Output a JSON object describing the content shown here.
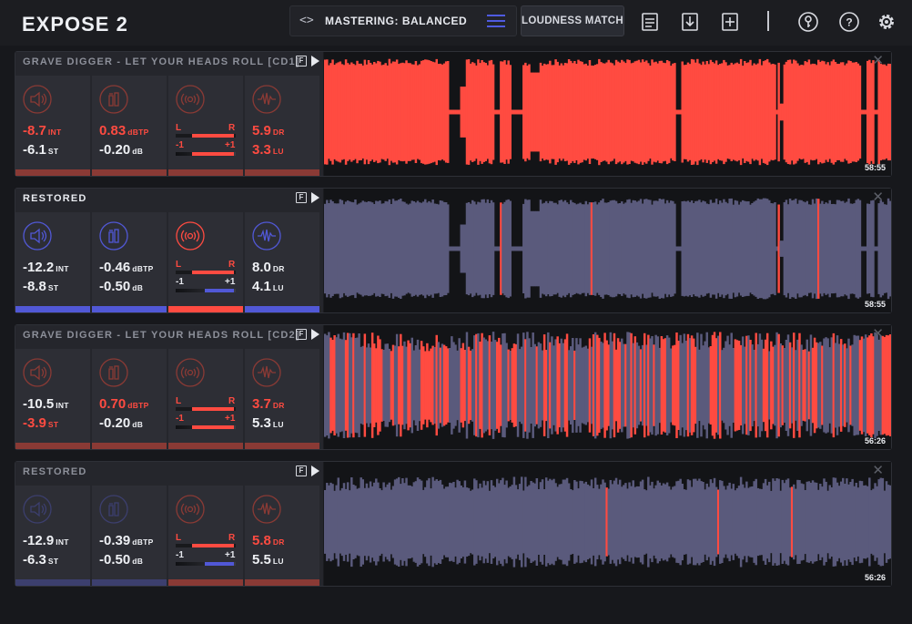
{
  "app": {
    "title": "EXPOSE 2"
  },
  "toolbar": {
    "preset_arrows": "<>",
    "preset_label": "MASTERING: BALANCED",
    "loudness_match": "LOUDNESS MATCH",
    "icons": [
      "report-icon",
      "export-icon",
      "add-file-icon",
      "key-icon",
      "help-icon",
      "settings-icon"
    ]
  },
  "colors": {
    "red": "#ff4b41",
    "blue": "#5158d6",
    "wave_blue": "#5a5a7c",
    "bg": "#17181c"
  },
  "tracks": [
    {
      "name": "GRAVE DIGGER - LET YOUR HEADS ROLL [CD1]",
      "name_active": false,
      "int_val": "-8.7",
      "int_unit": "INT",
      "st_val": "-6.1",
      "st_unit": "ST",
      "tp_val": "0.83",
      "tp_unit": "dBTP",
      "db_val": "-0.20",
      "db_unit": "dB",
      "dr_val": "5.9",
      "dr_unit": "DR",
      "lu_val": "3.3",
      "lu_unit": "LU",
      "L": "L",
      "R": "R",
      "neg": "-1",
      "pos": "+1",
      "time": "58:55",
      "wave_color": "red"
    },
    {
      "name": "RESTORED",
      "name_active": true,
      "int_val": "-12.2",
      "int_unit": "INT",
      "st_val": "-8.8",
      "st_unit": "ST",
      "tp_val": "-0.46",
      "tp_unit": "dBTP",
      "db_val": "-0.50",
      "db_unit": "dB",
      "dr_val": "8.0",
      "dr_unit": "DR",
      "lu_val": "4.1",
      "lu_unit": "LU",
      "L": "L",
      "R": "R",
      "neg": "-1",
      "pos": "+1",
      "time": "58:55",
      "wave_color": "blue"
    },
    {
      "name": "GRAVE DIGGER - LET YOUR HEADS ROLL [CD2]",
      "name_active": false,
      "int_val": "-10.5",
      "int_unit": "INT",
      "st_val": "-3.9",
      "st_unit": "ST",
      "tp_val": "0.70",
      "tp_unit": "dBTP",
      "db_val": "-0.20",
      "db_unit": "dB",
      "dr_val": "3.7",
      "dr_unit": "DR",
      "lu_val": "5.3",
      "lu_unit": "LU",
      "L": "L",
      "R": "R",
      "neg": "-1",
      "pos": "+1",
      "time": "56:26",
      "wave_color": "mixed"
    },
    {
      "name": "RESTORED",
      "name_active": false,
      "int_val": "-12.9",
      "int_unit": "INT",
      "st_val": "-6.3",
      "st_unit": "ST",
      "tp_val": "-0.39",
      "tp_unit": "dBTP",
      "db_val": "-0.50",
      "db_unit": "dB",
      "dr_val": "5.8",
      "dr_unit": "DR",
      "lu_val": "5.5",
      "lu_unit": "LU",
      "L": "L",
      "R": "R",
      "neg": "-1",
      "pos": "+1",
      "time": "56:26",
      "wave_color": "blue-sparse"
    }
  ]
}
